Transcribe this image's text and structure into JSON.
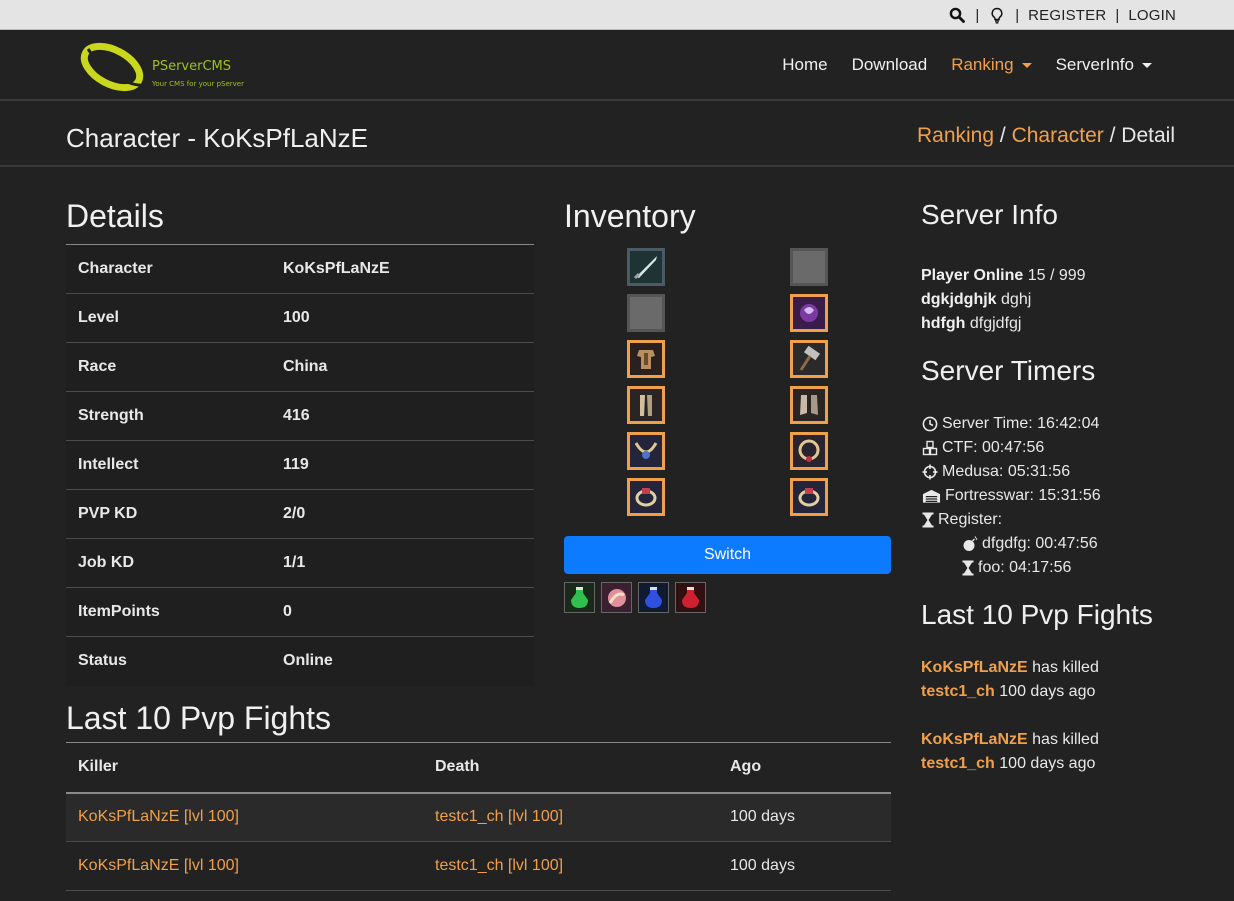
{
  "topbar": {
    "register_label": "REGISTER",
    "login_label": "LOGIN",
    "sep1": "|",
    "sep2": "|",
    "sep3": "|"
  },
  "brand": {
    "name": "PServerCMS",
    "tagline": "Your CMS for your pServer",
    "logo_color": "#c9d81a"
  },
  "nav": {
    "items": [
      {
        "label": "Home"
      },
      {
        "label": "Download"
      },
      {
        "label": "Ranking"
      },
      {
        "label": "ServerInfo"
      }
    ],
    "active_color": "#f0a04b"
  },
  "page": {
    "title": "Character - KoKsPfLaNzE",
    "breadcrumb": {
      "ranking": "Ranking",
      "sep1": "/",
      "character": "Character",
      "sep2": "/",
      "current": "Detail"
    }
  },
  "details": {
    "title": "Details",
    "rows": [
      {
        "label": "Character",
        "value": "KoKsPfLaNzE"
      },
      {
        "label": "Level",
        "value": "100"
      },
      {
        "label": "Race",
        "value": "China"
      },
      {
        "label": "Strength",
        "value": "416"
      },
      {
        "label": "Intellect",
        "value": "119"
      },
      {
        "label": "PVP KD",
        "value": "2/0"
      },
      {
        "label": "Job KD",
        "value": "1/1"
      },
      {
        "label": "ItemPoints",
        "value": "0"
      },
      {
        "label": "Status",
        "value": "Online"
      }
    ]
  },
  "inventory": {
    "title": "Inventory",
    "switch_label": "Switch",
    "slot_icons": [
      "sword-icon",
      "empty-slot",
      "empty-slot",
      "shield-icon",
      "chest-armor-icon",
      "hammer-icon",
      "legs-armor-icon",
      "boots-icon",
      "necklace-icon",
      "earring-icon",
      "ring-icon",
      "ring-icon"
    ],
    "potions": [
      "green-potion-icon",
      "scroll-icon",
      "blue-potion-icon",
      "red-potion-icon"
    ]
  },
  "pvp": {
    "title": "Last 10 Pvp Fights",
    "headers": {
      "killer": "Killer",
      "death": "Death",
      "ago": "Ago"
    },
    "rows": [
      {
        "killer": "KoKsPfLaNzE [lvl 100]",
        "death": "testc1_ch [lvl 100]",
        "ago": "100 days"
      },
      {
        "killer": "KoKsPfLaNzE [lvl 100]",
        "death": "testc1_ch [lvl 100]",
        "ago": "100 days"
      }
    ]
  },
  "server_info": {
    "title": "Server Info",
    "player_online_label": "Player Online",
    "player_online_value": "15 / 999",
    "extra": [
      {
        "label": "dgkjdghjk",
        "value": "dghj"
      },
      {
        "label": "hdfgh",
        "value": "dfgjdfgj"
      }
    ]
  },
  "server_timers": {
    "title": "Server Timers",
    "server_time": "Server Time: 16:42:04",
    "ctf": "CTF: 00:47:56",
    "medusa": "Medusa: 05:31:56",
    "fortresswar": "Fortresswar: 15:31:56",
    "register": "Register:",
    "sub": [
      {
        "text": "dfgdfg: 00:47:56"
      },
      {
        "text": "foo: 04:17:56"
      }
    ]
  },
  "side_pvp": {
    "title": "Last 10 Pvp Fights",
    "fights": [
      {
        "killer": "KoKsPfLaNzE",
        "verb": "has killed",
        "victim": "testc1_ch",
        "ago": "100 days ago"
      },
      {
        "killer": "KoKsPfLaNzE",
        "verb": "has killed",
        "victim": "testc1_ch",
        "ago": "100 days ago"
      }
    ]
  }
}
